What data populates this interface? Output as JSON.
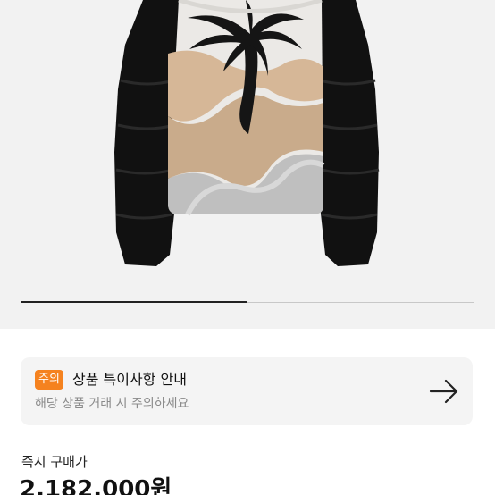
{
  "product": {
    "image_name": "puffer-jacket-palm-tree",
    "image_slide_progress": 0.5
  },
  "notice": {
    "badge": "주의",
    "title": "상품 특이사항 안내",
    "description": "해당 상품 거래 시 주의하세요",
    "arrow_icon": "arrow-right-icon",
    "accent_color": "#f5821f"
  },
  "price": {
    "label": "즉시 구매가",
    "value": "2,182,000원"
  }
}
